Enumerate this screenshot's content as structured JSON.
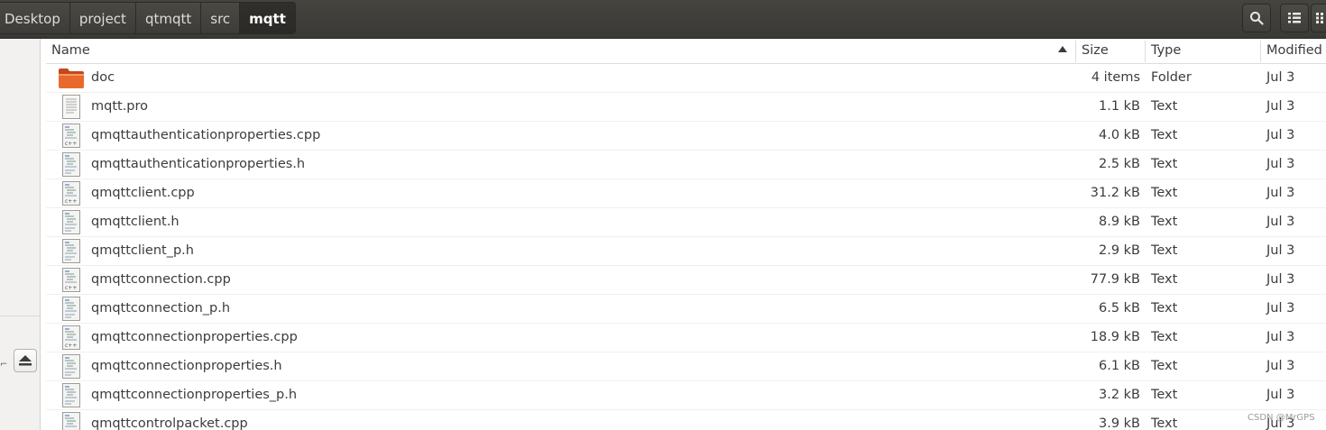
{
  "breadcrumbs": [
    "Desktop",
    "project",
    "qtmqtt",
    "src",
    "mqtt"
  ],
  "toolbar": {
    "search_icon": "search-icon",
    "view_icon": "list-view-icon",
    "menu_icon": "grid-menu-icon"
  },
  "columns": {
    "name": "Name",
    "size": "Size",
    "type": "Type",
    "modified": "Modified",
    "sort": "ascending"
  },
  "files": [
    {
      "name": "doc",
      "size": "4 items",
      "type": "Folder",
      "modified": "Jul 3",
      "icon": "folder"
    },
    {
      "name": "mqtt.pro",
      "size": "1.1 kB",
      "type": "Text",
      "modified": "Jul 3",
      "icon": "text"
    },
    {
      "name": "qmqttauthenticationproperties.cpp",
      "size": "4.0 kB",
      "type": "Text",
      "modified": "Jul 3",
      "icon": "cpp"
    },
    {
      "name": "qmqttauthenticationproperties.h",
      "size": "2.5 kB",
      "type": "Text",
      "modified": "Jul 3",
      "icon": "h"
    },
    {
      "name": "qmqttclient.cpp",
      "size": "31.2 kB",
      "type": "Text",
      "modified": "Jul 3",
      "icon": "cpp"
    },
    {
      "name": "qmqttclient.h",
      "size": "8.9 kB",
      "type": "Text",
      "modified": "Jul 3",
      "icon": "h"
    },
    {
      "name": "qmqttclient_p.h",
      "size": "2.9 kB",
      "type": "Text",
      "modified": "Jul 3",
      "icon": "h"
    },
    {
      "name": "qmqttconnection.cpp",
      "size": "77.9 kB",
      "type": "Text",
      "modified": "Jul 3",
      "icon": "cpp"
    },
    {
      "name": "qmqttconnection_p.h",
      "size": "6.5 kB",
      "type": "Text",
      "modified": "Jul 3",
      "icon": "h"
    },
    {
      "name": "qmqttconnectionproperties.cpp",
      "size": "18.9 kB",
      "type": "Text",
      "modified": "Jul 3",
      "icon": "cpp"
    },
    {
      "name": "qmqttconnectionproperties.h",
      "size": "6.1 kB",
      "type": "Text",
      "modified": "Jul 3",
      "icon": "h"
    },
    {
      "name": "qmqttconnectionproperties_p.h",
      "size": "3.2 kB",
      "type": "Text",
      "modified": "Jul 3",
      "icon": "h"
    },
    {
      "name": "qmqttcontrolpacket.cpp",
      "size": "3.9 kB",
      "type": "Text",
      "modified": "Jul 3",
      "icon": "cpp"
    }
  ],
  "sidebar": {
    "eject_icon": "eject-icon"
  },
  "watermark": "CSDN @MrGPS"
}
